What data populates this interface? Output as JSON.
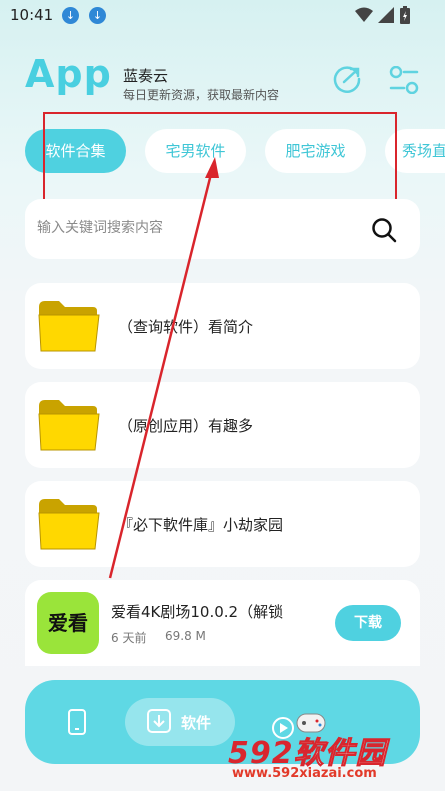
{
  "status_bar": {
    "time": "10:41"
  },
  "header": {
    "logo": "App",
    "name": "蓝奏云",
    "subtitle": "每日更新资源，获取最新内容"
  },
  "tabs": [
    {
      "label": "软件合集",
      "active": true
    },
    {
      "label": "宅男软件",
      "active": false
    },
    {
      "label": "肥宅游戏",
      "active": false
    },
    {
      "label": "秀场直",
      "active": false
    }
  ],
  "search": {
    "placeholder": "输入关键词搜索内容",
    "value": ""
  },
  "folders": [
    {
      "title": "（查询软件）看简介"
    },
    {
      "title": "（原创应用）有趣多"
    },
    {
      "title": "『必下軟件庫』小劫家园"
    }
  ],
  "app_item": {
    "icon_text": "爱看",
    "title": "爱看4K剧场10.0.2（解锁",
    "age": "6 天前",
    "size": "69.8 M",
    "download_label": "下载"
  },
  "bottom_nav": {
    "software_label": "软件"
  },
  "watermark": {
    "brand_num": "592",
    "brand_cn": "软件园",
    "url": "www.592xiazai.com"
  },
  "colors": {
    "accent": "#4fd1e0",
    "annotation": "#d9252c",
    "app_icon": "#9ae43a"
  }
}
